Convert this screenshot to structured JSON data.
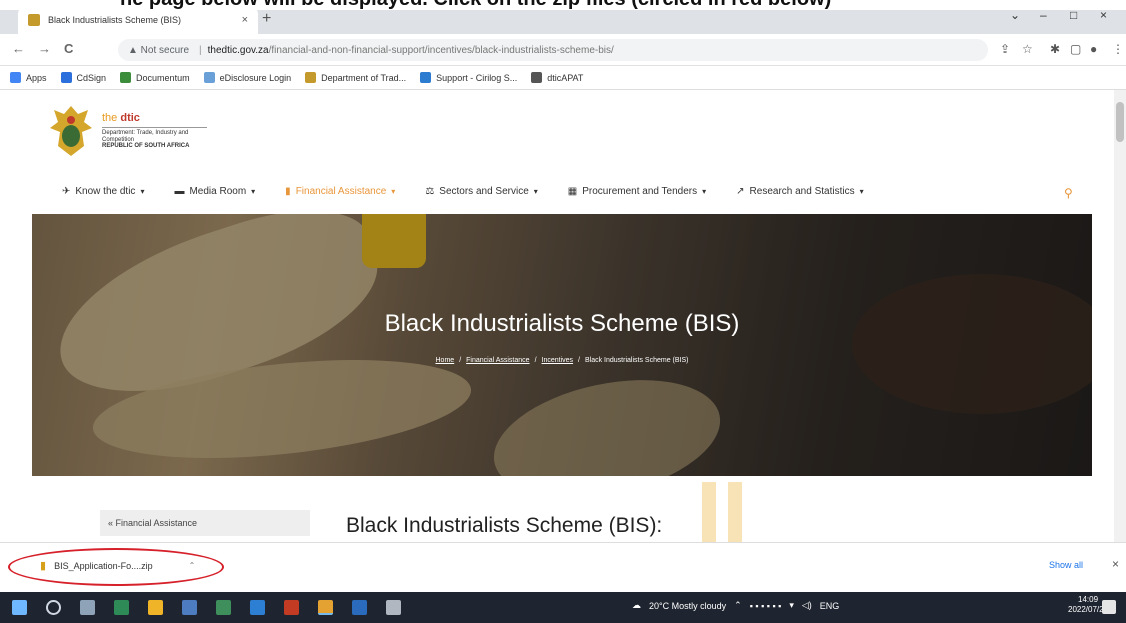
{
  "caption": {
    "text": "he page below will be displayed. Click on the zip files (circled in red below)"
  },
  "browser": {
    "tab_title": "Black Industrialists Scheme (BIS)",
    "tab_close": "×",
    "new_tab": "+",
    "window_controls": [
      "⌄",
      "–",
      "□",
      "×"
    ],
    "nav": {
      "back": "←",
      "forward": "→",
      "reload": "C"
    },
    "omnibox": {
      "warning": "▲ Not secure",
      "host": "thedtic.gov.za",
      "path": "/financial-and-non-financial-support/incentives/black-industrialists-scheme-bis/"
    }
  },
  "bookmarks": [
    {
      "label": "Apps",
      "color": "#4285f4"
    },
    {
      "label": "CdSign",
      "color": "#2a6fdb"
    },
    {
      "label": "Documentum",
      "color": "#3b8d3b"
    },
    {
      "label": "eDisclosure Login",
      "color": "#6aa0d8"
    },
    {
      "label": "Department of Trad...",
      "color": "#c59a2c"
    },
    {
      "label": "Support - Cirilog S...",
      "color": "#2b7bd0"
    },
    {
      "label": "dticAPAT",
      "color": "#555555"
    }
  ],
  "logo": {
    "the": "the",
    "dtic": "dtic",
    "dept": "Department: Trade, Industry and Competition",
    "rsa": "REPUBLIC OF SOUTH AFRICA"
  },
  "mainnav": [
    {
      "label": "Know the dtic",
      "icon": "✈",
      "active": false
    },
    {
      "label": "Media Room",
      "icon": "▬",
      "active": false
    },
    {
      "label": "Financial Assistance",
      "icon": "▮",
      "active": true
    },
    {
      "label": "Sectors and Service",
      "icon": "⚖",
      "active": false
    },
    {
      "label": "Procurement and Tenders",
      "icon": "▦",
      "active": false
    },
    {
      "label": "Research and Statistics",
      "icon": "↗",
      "active": false
    }
  ],
  "hero": {
    "title": "Black Industrialists Scheme (BIS)",
    "breadcrumb": [
      "Home",
      "Financial Assistance",
      "Incentives",
      "Black Industrialists Scheme (BIS)"
    ]
  },
  "sidebar": {
    "back_link": "« Financial Assistance"
  },
  "content": {
    "title": "Black Industrialists Scheme (BIS):"
  },
  "download": {
    "filename": "BIS_Application-Fo....zip",
    "show_all": "Show all",
    "close": "×"
  },
  "taskbar": {
    "weather": "20°C  Mostly cloudy",
    "lang": "ENG",
    "time": "14:09",
    "date": "2022/07/27"
  },
  "colors": {
    "accent": "#e8963a",
    "highlight_circle": "#d6202a",
    "taskbar": "#1f2530"
  }
}
